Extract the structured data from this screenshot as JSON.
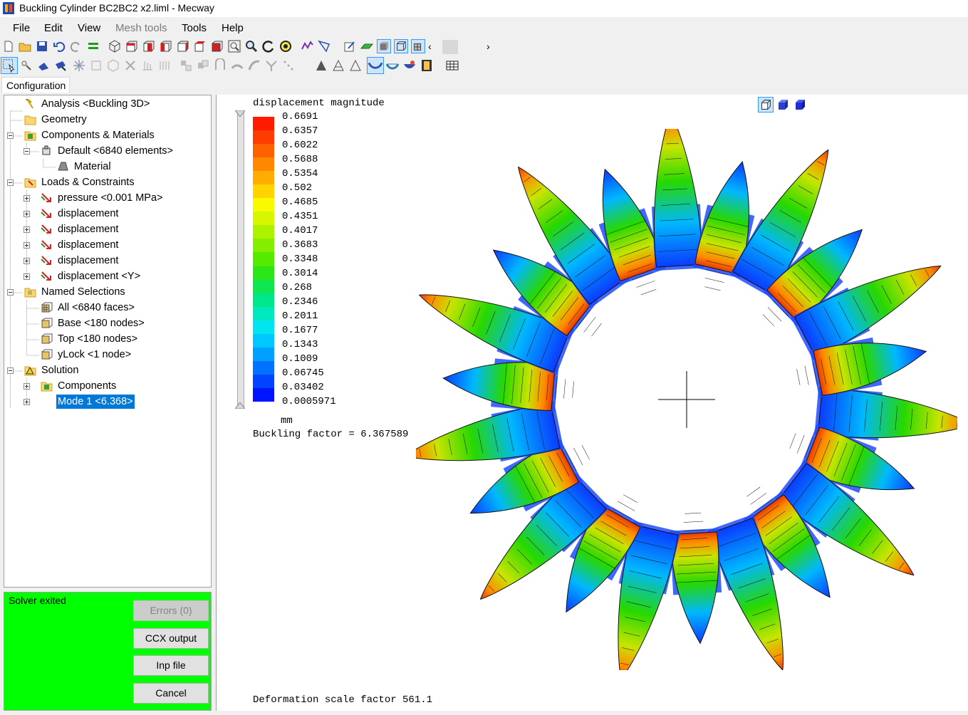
{
  "window": {
    "title": "Buckling Cylinder BC2BC2 x2.liml - Mecway"
  },
  "menu": {
    "file": "File",
    "edit": "Edit",
    "view": "View",
    "mesh_tools": "Mesh tools",
    "tools": "Tools",
    "help": "Help"
  },
  "tabs": {
    "configuration": "Configuration"
  },
  "tree": {
    "analysis": "Analysis <Buckling 3D>",
    "geometry": "Geometry",
    "components_materials": "Components & Materials",
    "default_component": "Default <6840 elements>",
    "material": "Material",
    "loads_constraints": "Loads & Constraints",
    "pressure": "pressure <0.001 MPa>",
    "displacement_1": "displacement",
    "displacement_2": "displacement",
    "displacement_3": "displacement",
    "displacement_4": "displacement",
    "displacement_y": "displacement <Y>",
    "named_selections": "Named Selections",
    "all_faces": "All <6840 faces>",
    "base_nodes": "Base <180 nodes>",
    "top_nodes": "Top <180 nodes>",
    "ylock": "yLock <1 node>",
    "solution": "Solution",
    "solution_components": "Components",
    "mode1": "Mode 1 <6.368>"
  },
  "status": {
    "text": "Solver exited",
    "errors_button": "Errors (0)",
    "ccx_button": "CCX output",
    "inp_button": "Inp file",
    "cancel_button": "Cancel",
    "panel_color": "#00ff00"
  },
  "viewport": {
    "result_title": "displacement magnitude",
    "legend_values": [
      "0.6691",
      "0.6357",
      "0.6022",
      "0.5688",
      "0.5354",
      "0.502",
      "0.4685",
      "0.4351",
      "0.4017",
      "0.3683",
      "0.3348",
      "0.3014",
      "0.268",
      "0.2346",
      "0.2011",
      "0.1677",
      "0.1343",
      "0.1009",
      "0.06745",
      "0.03402",
      "0.0005971"
    ],
    "legend_colors": [
      "#ff1a00",
      "#ff3c00",
      "#ff6100",
      "#ff8800",
      "#ffae00",
      "#ffd400",
      "#f9f900",
      "#d6f700",
      "#aef200",
      "#83ee00",
      "#56ea00",
      "#2de61a",
      "#10e650",
      "#00e68a",
      "#00e8c0",
      "#00e6f0",
      "#00c8ff",
      "#00a0ff",
      "#0072ff",
      "#0044ff",
      "#0015ff"
    ],
    "unit": "mm",
    "buckling_factor": "Buckling factor = 6.367589",
    "deformation_scale": "Deformation scale factor 561.1",
    "mode_shape": {
      "lobes": 22,
      "symmetry": "22-fold",
      "colors": {
        "min": "#0a3cff",
        "mid": "#27d800",
        "max": "#e83a00"
      }
    }
  },
  "icons": {
    "toolbar1": [
      "new-file-icon",
      "open-folder-icon",
      "save-icon",
      "undo-icon",
      "redo-icon",
      "equals-icon",
      "view-iso-icon",
      "view-front-icon",
      "view-back-icon",
      "view-left-icon",
      "view-right-icon",
      "view-top-icon",
      "view-bottom-icon",
      "zoom-window-icon",
      "zoom-icon",
      "rotate-icon",
      "pan-icon",
      "solve-icon",
      "mesh-icon",
      "edit-icon",
      "surface-icon",
      "shaded-icon",
      "wireframe-icon",
      "mesh-edges-icon"
    ],
    "toolbar2": [
      "select-icon",
      "node-select-icon",
      "element-select-icon",
      "face-select-icon",
      "point-icon",
      "box-icon",
      "cube-icon",
      "delete-icon",
      "extrude-icon",
      "revolve-icon",
      "move-icon",
      "copy-icon",
      "mirror-icon",
      "bend-icon",
      "split-icon",
      "merge-icon",
      "scale-icon",
      "triangle-icon",
      "triangle-outline-icon",
      "deformed-shape-icon",
      "undeformed-shape-icon",
      "animate-icon",
      "film-icon",
      "table-icon"
    ]
  }
}
